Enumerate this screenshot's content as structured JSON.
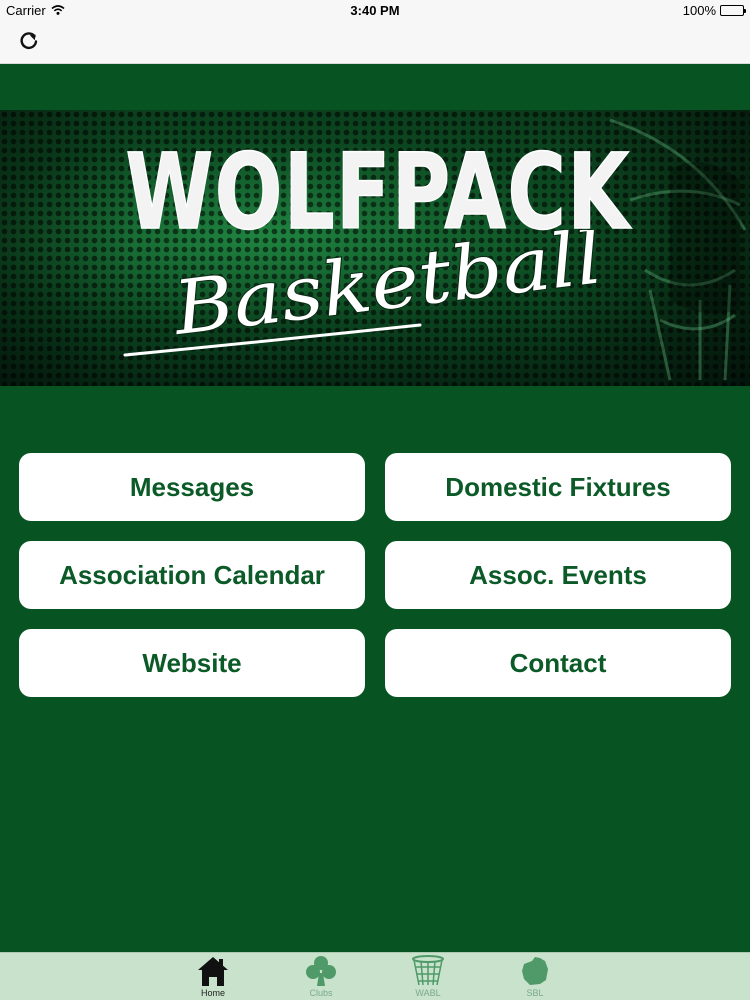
{
  "status_bar": {
    "carrier": "Carrier",
    "time": "3:40 PM",
    "battery": "100%"
  },
  "banner": {
    "title": "WOLFPACK",
    "subtitle": "Basketball"
  },
  "buttons": [
    {
      "label": "Messages"
    },
    {
      "label": "Domestic Fixtures"
    },
    {
      "label": "Association Calendar"
    },
    {
      "label": "Assoc. Events"
    },
    {
      "label": "Website"
    },
    {
      "label": "Contact"
    }
  ],
  "tabs": [
    {
      "label": "Home",
      "icon": "home-icon",
      "active": true
    },
    {
      "label": "Clubs",
      "icon": "clubs-icon",
      "active": false
    },
    {
      "label": "WABL",
      "icon": "basketball-net-icon",
      "active": false
    },
    {
      "label": "SBL",
      "icon": "map-icon",
      "active": false
    }
  ],
  "colors": {
    "brand_green": "#075321",
    "button_text": "#0b5a27",
    "tab_bar": "#c8e2cb"
  }
}
